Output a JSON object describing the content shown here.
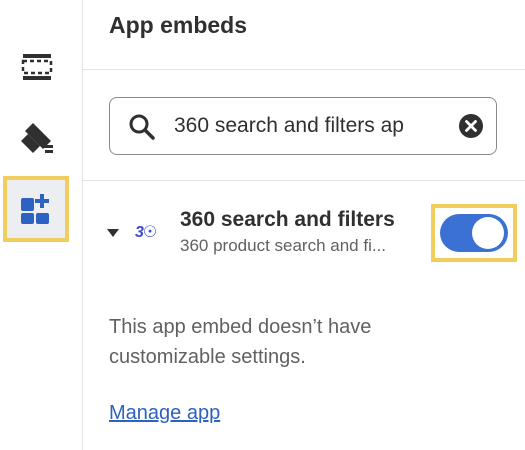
{
  "sidebar": {
    "items": [
      {
        "icon": "sections-icon",
        "active": false
      },
      {
        "icon": "theme-settings-icon",
        "active": false
      },
      {
        "icon": "app-embeds-icon",
        "active": true
      }
    ]
  },
  "header": {
    "title": "App embeds"
  },
  "search": {
    "value": "360 search and filters ap",
    "icon": "search-icon",
    "clear_icon": "clear-icon"
  },
  "embed": {
    "logo_text": "3☉",
    "name": "360 search and filters",
    "description": "360 product search and fi...",
    "enabled": true
  },
  "message": "This app embed doesn’t have customizable settings.",
  "manage_link": "Manage app",
  "colors": {
    "toggle_on": "#3a71d3",
    "highlight": "#f0cd5d",
    "link": "#2d62c2",
    "icon": "#303030"
  }
}
